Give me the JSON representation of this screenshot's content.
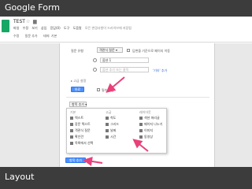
{
  "slide": {
    "title": "Google Form",
    "footer": "Layout"
  },
  "app": {
    "doc_title": "TEST",
    "menu": [
      "파일",
      "수정",
      "보기",
      "삽입",
      "응답(0)",
      "도구",
      "도움말"
    ],
    "save_status": "모든 변경사항이 드라이브에 저장됨",
    "toolbar": [
      "수정",
      "질문 추가",
      "테마: 기본"
    ]
  },
  "question": {
    "type_label": "질문 유형",
    "type_value": "객관식 질문",
    "page_nav_label": "답변을 기준으로 페이지 이동",
    "option1": "옵션 1",
    "option2_placeholder": "옵션 추가 또는 클릭",
    "add_other": "'기타' 추가",
    "advanced": "▸ 고급 설정",
    "done_button": "완료",
    "required_label": "필수 질문"
  },
  "add_item": {
    "button_label": "항목 추가",
    "columns": {
      "basic": {
        "header": "기본",
        "items": [
          "텍스트",
          "장문 텍스트",
          "객관식 질문",
          "확인란",
          "목록에서 선택"
        ]
      },
      "advanced": {
        "header": "고급",
        "items": [
          "척도",
          "그리드",
          "날짜",
          "시간"
        ]
      },
      "layout": {
        "header": "레이아웃",
        "items": [
          "섹션 머리글",
          "페이지 나누기",
          "이미지",
          "동영상"
        ]
      }
    },
    "submit_button": "항목 추가"
  },
  "colors": {
    "slide_bar": "#3c3c3c",
    "accent_blue": "#4d90fe",
    "arrow_pink": "#e8407a",
    "forms_green": "#16a765"
  }
}
